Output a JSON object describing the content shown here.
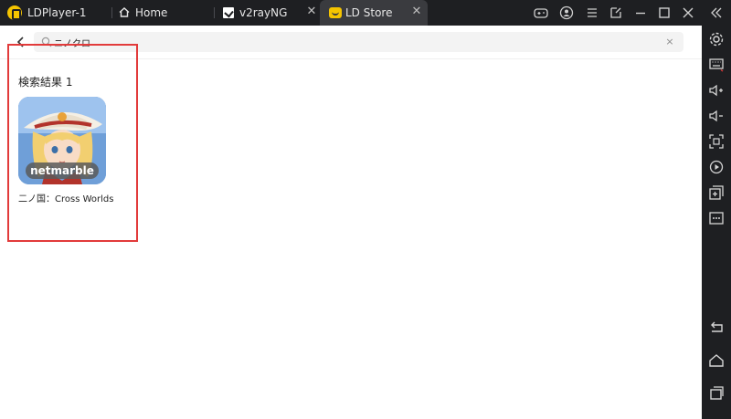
{
  "titlebar": {
    "app_title": "LDPlayer-1",
    "tabs": [
      {
        "label": "Home"
      },
      {
        "label": "v2rayNG"
      },
      {
        "label": "LD Store"
      }
    ]
  },
  "search": {
    "query": "ニノクロ",
    "clear_label": "×"
  },
  "results": {
    "heading": "検索結果 1",
    "items": [
      {
        "name": "二ノ国：Cross Worlds",
        "badge_text": "netmarble"
      }
    ]
  },
  "colors": {
    "accent": "#f5c400",
    "highlight": "#e23b3b",
    "titlebar_bg": "#1e1f22",
    "active_tab_bg": "#3a3b3f"
  },
  "icons": {
    "sidebar": [
      "settings-gear-icon",
      "keyboard-icon",
      "volume-up-icon",
      "volume-down-icon",
      "screenshot-icon",
      "record-icon",
      "add-window-icon",
      "more-icon",
      "back-icon",
      "home-icon",
      "recent-apps-icon"
    ]
  }
}
